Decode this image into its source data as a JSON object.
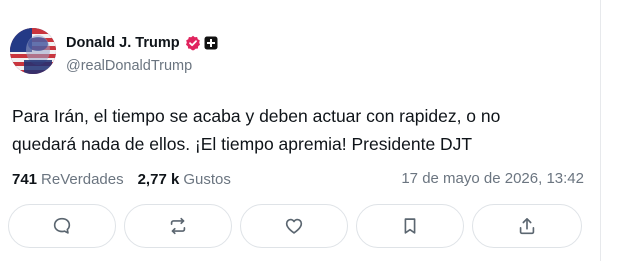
{
  "author": {
    "display_name": "Donald J. Trump",
    "handle": "@realDonaldTrump"
  },
  "post": {
    "line1": "Para Irán, el tiempo se acaba y deben actuar con rapidez, o no",
    "line2": "quedará nada de ellos. ¡El tiempo apremia! Presidente DJT"
  },
  "stats": {
    "reposts_count": "741",
    "reposts_label": "ReVerdades",
    "likes_count": "2,77 k",
    "likes_label": "Gustos",
    "timestamp": "17 de mayo de 2026, 13:42"
  },
  "colors": {
    "verified_badge": "#e0245e",
    "icon_stroke": "#5b6670",
    "muted_text": "#6b7580"
  },
  "icons": {
    "reply": "chat-bubble-icon",
    "repost": "repost-arrows-icon",
    "like": "heart-icon",
    "bookmark": "bookmark-icon",
    "share": "share-upload-icon"
  }
}
